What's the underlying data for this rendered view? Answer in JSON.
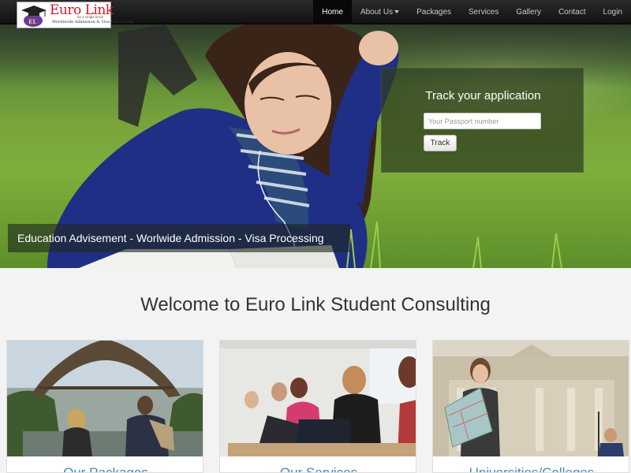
{
  "brand": {
    "name": "Euro Link",
    "small": "by a single brain",
    "tagline": "Worldwide Admission & Visa Processing",
    "emblem": "EL"
  },
  "nav": {
    "items": [
      {
        "label": "Home",
        "active": true
      },
      {
        "label": "About Us",
        "dropdown": true
      },
      {
        "label": "Packages"
      },
      {
        "label": "Services"
      },
      {
        "label": "Gallery"
      },
      {
        "label": "Contact"
      },
      {
        "label": "Login"
      }
    ]
  },
  "hero": {
    "track_title": "Track your application",
    "track_placeholder": "Your Passport number",
    "track_value": "",
    "track_button": "Track",
    "tagline": "Education Advisement - Worlwide Admission - Visa Processing"
  },
  "welcome": "Welcome to Euro Link Student Consulting",
  "cards": [
    {
      "title": "Our Packages",
      "image": "eiffel-tower-photo"
    },
    {
      "title": "Our Services",
      "image": "students-laptops-photo"
    },
    {
      "title": "Universities/Colleges",
      "image": "student-with-map-photo"
    }
  ],
  "colors": {
    "brand_red": "#c21f2b",
    "navbar": "#1b1b1b",
    "card_title": "#3d8fc1"
  }
}
